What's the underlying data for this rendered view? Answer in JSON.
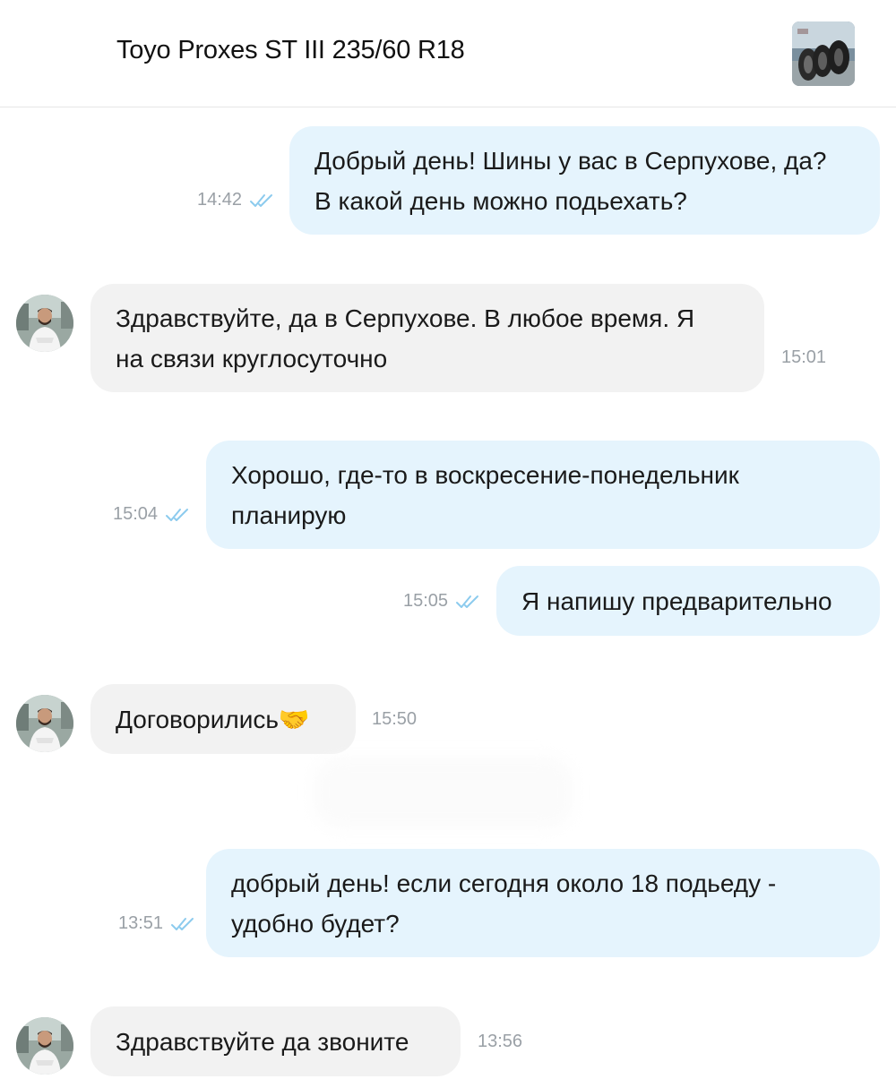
{
  "header": {
    "title": "Toyo Proxes ST III 235/60 R18"
  },
  "messages": [
    {
      "direction": "out",
      "text": "Добрый день! Шины у вас в Серпухове, да?\nВ какой день можно подьехать?",
      "time": "14:42",
      "status": "read"
    },
    {
      "direction": "in",
      "text": "Здравствуйте, да в Серпухове. В любое время. Я\nна связи круглосуточно",
      "time": "15:01"
    },
    {
      "direction": "out",
      "text": "Хорошо, где-то в воскресение-понедельник\nпланирую",
      "time": "15:04",
      "status": "read"
    },
    {
      "direction": "out",
      "text": "Я напишу предварительно",
      "time": "15:05",
      "status": "read"
    },
    {
      "direction": "in",
      "text": "Договорились🤝",
      "time": "15:50"
    },
    {
      "direction": "out",
      "text": "добрый день! если сегодня около 18  подьеду -\nудобно будет?",
      "time": "13:51",
      "status": "read"
    },
    {
      "direction": "in",
      "text": "Здравствуйте да звоните",
      "time": "13:56"
    }
  ],
  "colors": {
    "outgoing_bubble": "#e5f4fd",
    "incoming_bubble": "#f2f2f2",
    "read_check": "#8ccbee",
    "time_text": "#9aa0a6"
  },
  "icons": {
    "read_status": "double-check-icon",
    "listing_thumbnail": "tire-photo",
    "seller_avatar": "avatar"
  }
}
